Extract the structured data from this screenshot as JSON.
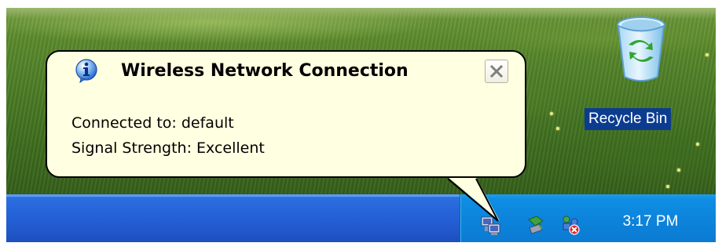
{
  "balloon": {
    "title": "Wireless Network Connection",
    "lines": [
      "Connected to: default",
      "Signal Strength: Excellent"
    ],
    "icon": "info-icon",
    "close_icon": "close-icon"
  },
  "desktop": {
    "recycle_bin": {
      "label": "Recycle Bin",
      "icon": "recycle-bin-icon"
    }
  },
  "taskbar": {
    "tray": {
      "icons": [
        "wireless-network-icon",
        "safely-remove-hardware-icon",
        "network-error-icon"
      ],
      "clock": "3:17 PM"
    }
  },
  "colors": {
    "balloon_bg": "#ffffe1",
    "taskbar": "#2563d8",
    "tray": "#0d84dc",
    "selection": "#0b3c8f"
  }
}
